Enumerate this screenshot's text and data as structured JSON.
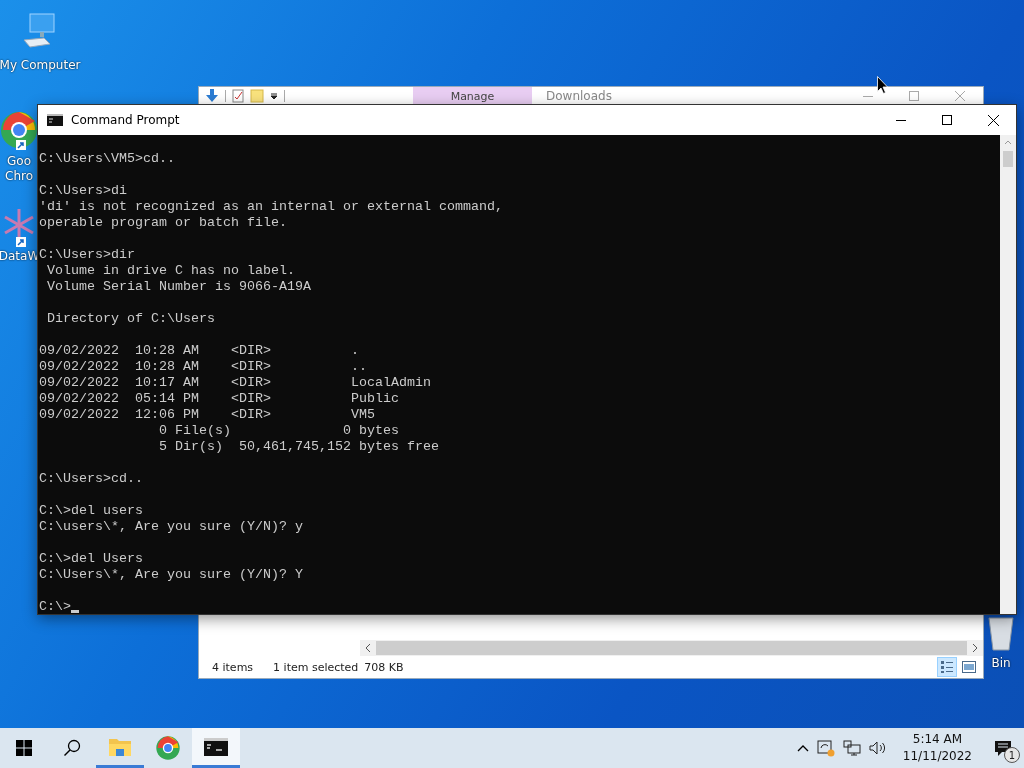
{
  "desktop": {
    "icons": [
      {
        "kind": "computer",
        "label_lines": [
          "My Computer"
        ]
      },
      {
        "kind": "chrome",
        "label_lines": [
          "Goo",
          "Chro"
        ]
      },
      {
        "kind": "datawrapper",
        "label_lines": [
          "DataW"
        ]
      },
      {
        "kind": "recycle",
        "label_lines": [
          "Bin"
        ]
      }
    ]
  },
  "explorer": {
    "ribbon_tab": "Manage",
    "title": "Downloads",
    "status": {
      "count": "4 items",
      "selection": "1 item selected",
      "size": "708 KB"
    },
    "views": [
      {
        "kind": "details",
        "selected": true
      },
      {
        "kind": "tiles",
        "selected": false
      }
    ]
  },
  "console": {
    "title": "Command Prompt",
    "blocks": [
      [
        "C:\\Users\\VM5>cd.."
      ],
      [
        "C:\\Users>di",
        "'di' is not recognized as an internal or external command,",
        "operable program or batch file."
      ],
      [
        "C:\\Users>dir",
        " Volume in drive C has no label.",
        " Volume Serial Number is 9066-A19A"
      ],
      [
        " Directory of C:\\Users"
      ],
      [
        "09/02/2022  10:28 AM    <DIR>          .",
        "09/02/2022  10:28 AM    <DIR>          ..",
        "09/02/2022  10:17 AM    <DIR>          LocalAdmin",
        "09/02/2022  05:14 PM    <DIR>          Public",
        "09/02/2022  12:06 PM    <DIR>          VM5",
        "               0 File(s)              0 bytes",
        "               5 Dir(s)  50,461,745,152 bytes free"
      ],
      [
        "C:\\Users>cd.."
      ],
      [
        "C:\\>del users",
        "C:\\users\\*, Are you sure (Y/N)? y"
      ],
      [
        "C:\\>del Users",
        "C:\\Users\\*, Are you sure (Y/N)? Y"
      ],
      [
        "C:\\>"
      ]
    ]
  },
  "taskbar": {
    "apps": [
      {
        "kind": "explorer",
        "running": true,
        "active": false
      },
      {
        "kind": "chrome",
        "running": false,
        "active": false
      },
      {
        "kind": "console",
        "running": true,
        "active": true
      }
    ],
    "clock": {
      "time": "5:14 AM",
      "date": "11/11/2022"
    },
    "notification_count": "1"
  }
}
